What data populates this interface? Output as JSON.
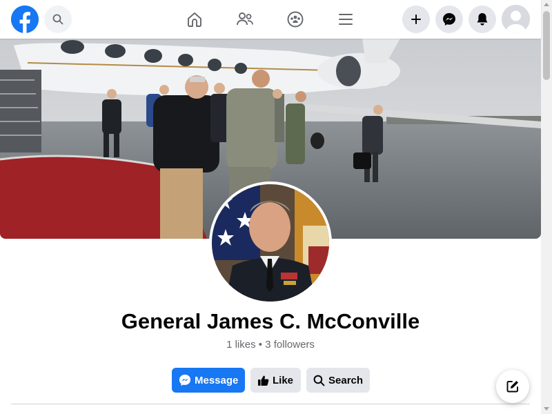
{
  "header": {
    "logo_icon": "facebook-logo-icon",
    "search_icon": "search-icon",
    "nav": [
      "home-icon",
      "friends-icon",
      "groups-icon",
      "menu-icon"
    ],
    "actions": [
      "plus-icon",
      "messenger-icon",
      "bell-icon",
      "avatar"
    ]
  },
  "profile": {
    "name": "General James C. McConville",
    "likes": "1 likes",
    "separator": "•",
    "followers": "3 followers"
  },
  "buttons": {
    "message_label": "Message",
    "like_label": "Like",
    "search_label": "Search"
  },
  "colors": {
    "brand": "#1877f2",
    "text_primary": "#050505",
    "text_secondary": "#65676b",
    "button_bg": "#e4e6eb"
  }
}
